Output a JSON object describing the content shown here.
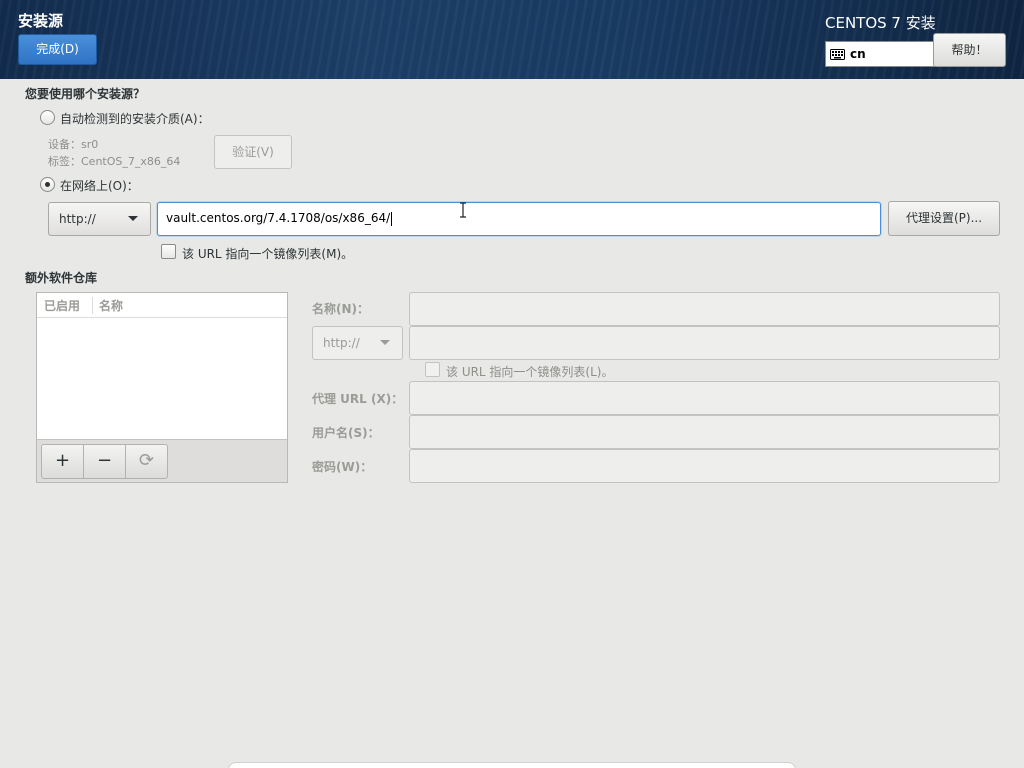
{
  "header": {
    "title": "安装源",
    "done_label": "完成(D)",
    "product": "CENTOS 7 安装",
    "keyboard_layout": "cn",
    "help_label": "帮助！"
  },
  "source": {
    "question": "您要使用哪个安装源？",
    "auto_detect_label": "自动检测到的安装介质(A)：",
    "auto_detect_checked": false,
    "device_line": "设备：sr0",
    "label_line": "标签：CentOS_7_x86_64",
    "verify_label": "验证(V)",
    "network_label": "在网络上(O)：",
    "network_checked": true,
    "protocol": "http://",
    "url_value": "vault.centos.org/7.4.1708/os/x86_64/",
    "proxy_label": "代理设置(P)...",
    "mirror_label": "该 URL 指向一个镜像列表(M)。",
    "mirror_checked": false
  },
  "repos": {
    "section_title": "额外软件仓库",
    "columns": [
      "已启用",
      "名称"
    ],
    "add_label": "+",
    "remove_label": "−",
    "refresh_label": "⟳",
    "form": {
      "name_label": "名称(N)：",
      "protocol": "http://",
      "mirror_label": "该 URL 指向一个镜像列表(L)。",
      "proxy_url_label": "代理 URL (X)：",
      "username_label": "用户名(S)：",
      "password_label": "密码(W)："
    }
  },
  "colors": {
    "header_bg": "#1b3d66",
    "accent_blue": "#4a90d9",
    "page_bg": "#e8e8e7"
  }
}
